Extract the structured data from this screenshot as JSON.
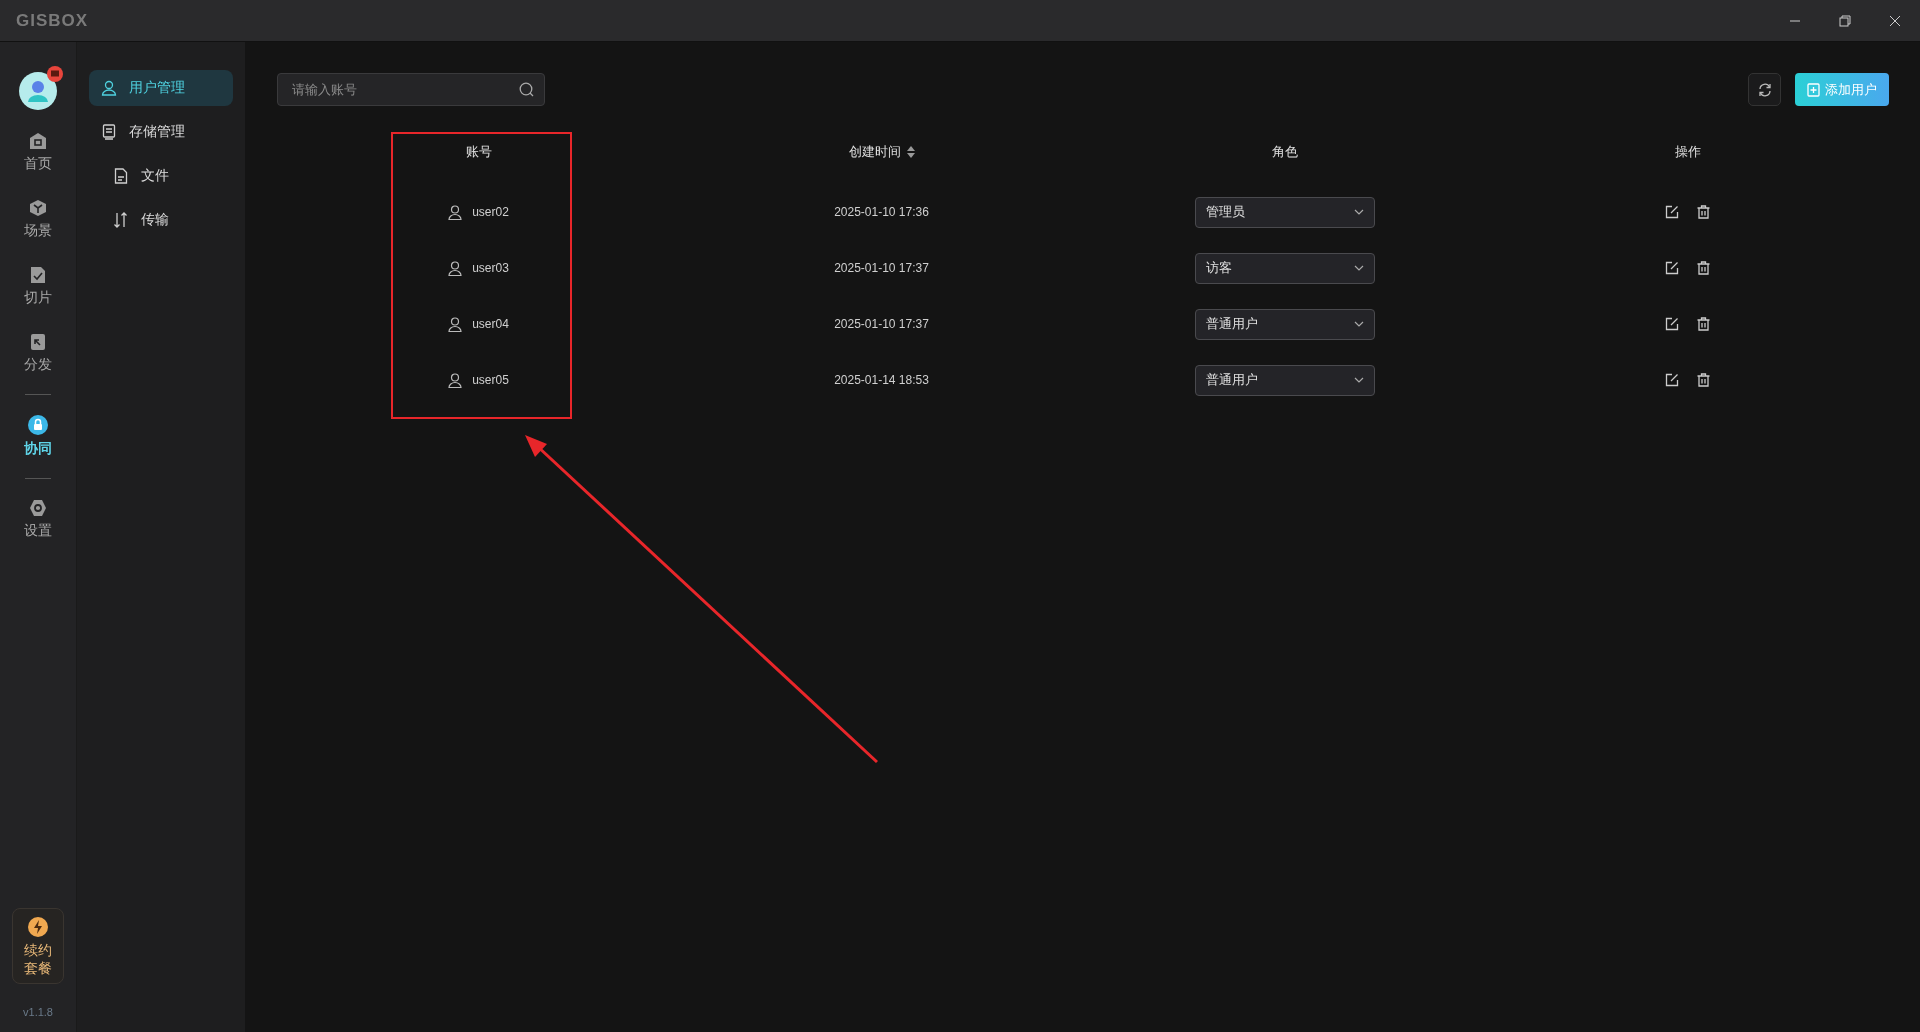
{
  "window": {
    "logo": "GISBOX"
  },
  "rail": {
    "avatar": {
      "notification": true
    },
    "groups": [
      [
        {
          "label": "首页",
          "selected": false
        },
        {
          "label": "场景",
          "selected": false
        },
        {
          "label": "切片",
          "selected": false
        },
        {
          "label": "分发",
          "selected": false
        }
      ],
      [
        {
          "label": "协同",
          "selected": true
        }
      ],
      [
        {
          "label": "设置",
          "selected": false
        }
      ]
    ],
    "promo": {
      "lines": [
        "续约",
        "套餐"
      ]
    },
    "version": "v1.1.8"
  },
  "subnav": [
    {
      "label": "用户管理",
      "selected": true
    },
    {
      "label": "存储管理",
      "selected": false,
      "children": [
        {
          "label": "文件",
          "selected": false
        },
        {
          "label": "传输",
          "selected": false
        }
      ]
    }
  ],
  "search": {
    "placeholder": "请输入账号"
  },
  "toolbar": {
    "add_button": "添加用户"
  },
  "table": {
    "columns": [
      {
        "label": "账号",
        "sortable": false
      },
      {
        "label": "创建时间",
        "sortable": true
      },
      {
        "label": "角色",
        "sortable": false
      },
      {
        "label": "操作",
        "sortable": false
      }
    ],
    "rows": [
      {
        "account": "user02",
        "created": "2025-01-10 17:36",
        "role": "管理员"
      },
      {
        "account": "user03",
        "created": "2025-01-10 17:37",
        "role": "访客"
      },
      {
        "account": "user04",
        "created": "2025-01-10 17:37",
        "role": "普通用户"
      },
      {
        "account": "user05",
        "created": "2025-01-14 18:53",
        "role": "普通用户"
      }
    ]
  },
  "annotation": {
    "kind": "box_and_arrow"
  }
}
